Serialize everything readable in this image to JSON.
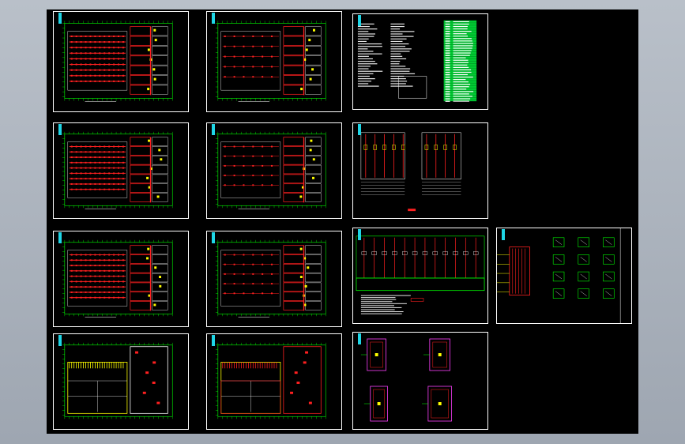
{
  "workspace": {
    "title": "",
    "colors": {
      "background": "#000000",
      "frame": "#ffffff",
      "grid": "#00ff00",
      "wiring": "#ff2020",
      "device": "#ffff00",
      "tag": "#1fd6e6",
      "table": "#00cc33"
    }
  },
  "sheets": [
    {
      "id": "sheet-1-1",
      "kind": "floor-plan-dense",
      "col": 1,
      "row": 1
    },
    {
      "id": "sheet-2-1",
      "kind": "floor-plan-sparse",
      "col": 2,
      "row": 1
    },
    {
      "id": "sheet-3-1",
      "kind": "legend-and-notes",
      "col": 3,
      "row": 1
    },
    {
      "id": "sheet-1-2",
      "kind": "floor-plan-dense",
      "col": 1,
      "row": 2
    },
    {
      "id": "sheet-2-2",
      "kind": "floor-plan-sparse",
      "col": 2,
      "row": 2
    },
    {
      "id": "sheet-3-2",
      "kind": "riser-schedule",
      "col": 3,
      "row": 2
    },
    {
      "id": "sheet-1-3",
      "kind": "floor-plan-dense",
      "col": 1,
      "row": 3
    },
    {
      "id": "sheet-2-3",
      "kind": "floor-plan-sparse",
      "col": 2,
      "row": 3
    },
    {
      "id": "sheet-3-3",
      "kind": "panel-schedule",
      "col": 3,
      "row": 3
    },
    {
      "id": "sheet-4-3",
      "kind": "system-diagram",
      "col": 4,
      "row": 3
    },
    {
      "id": "sheet-1-4",
      "kind": "roof-plan",
      "col": 1,
      "row": 4
    },
    {
      "id": "sheet-2-4",
      "kind": "roof-plan-grounding",
      "col": 2,
      "row": 4
    },
    {
      "id": "sheet-3-4",
      "kind": "detail-plans",
      "col": 3,
      "row": 4
    }
  ]
}
